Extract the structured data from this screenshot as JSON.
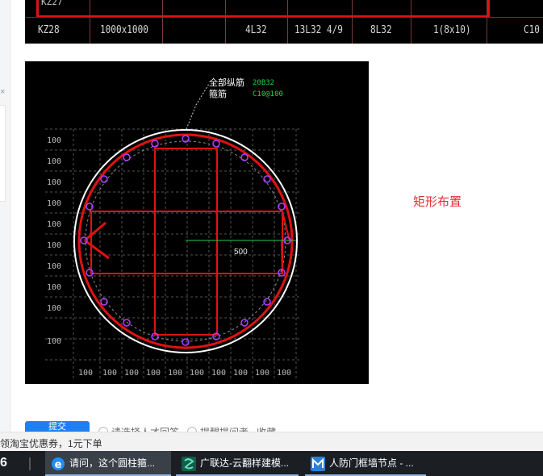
{
  "table": {
    "cut_row_text": "KZ27",
    "row": [
      "KZ28",
      "1000x1000",
      "4L32",
      "13L32 4/9",
      "8L32",
      "1(8x10)",
      "C10"
    ]
  },
  "cad": {
    "label_all_bars": "全部纵筋",
    "label_all_bars_value": "20B32",
    "label_stirrup": "箍筋",
    "label_stirrup_value": "C10@100",
    "dimension": "500",
    "left_ticks": [
      "100",
      "100",
      "100",
      "100",
      "100",
      "100",
      "100",
      "100",
      "100",
      "100"
    ],
    "bottom_ticks": [
      "100",
      "100",
      "100",
      "100",
      "100",
      "100",
      "100",
      "100",
      "100",
      "100"
    ]
  },
  "caption": "矩形布置",
  "under": {
    "button_label": "提交",
    "option1": "请选择人才回答",
    "option2": "提醒提问者",
    "option3": "收藏"
  },
  "promo_text": "领淘宝优惠券，1元下单",
  "taskbar": {
    "items": [
      {
        "label": "请问，这个圆柱箍...",
        "icon": "ie-browser-icon"
      },
      {
        "label": "广联达-云翻样建模...",
        "icon": "glodon-app-icon"
      },
      {
        "label": "人防门框墙节点 - ...",
        "icon": "document-app-icon"
      }
    ]
  },
  "colors": {
    "red": "#e01212",
    "caption": "#e0302f",
    "purple_bar": "#b040ff",
    "green_label": "#22d04a",
    "taskbar_bg": "#1b1f24"
  }
}
